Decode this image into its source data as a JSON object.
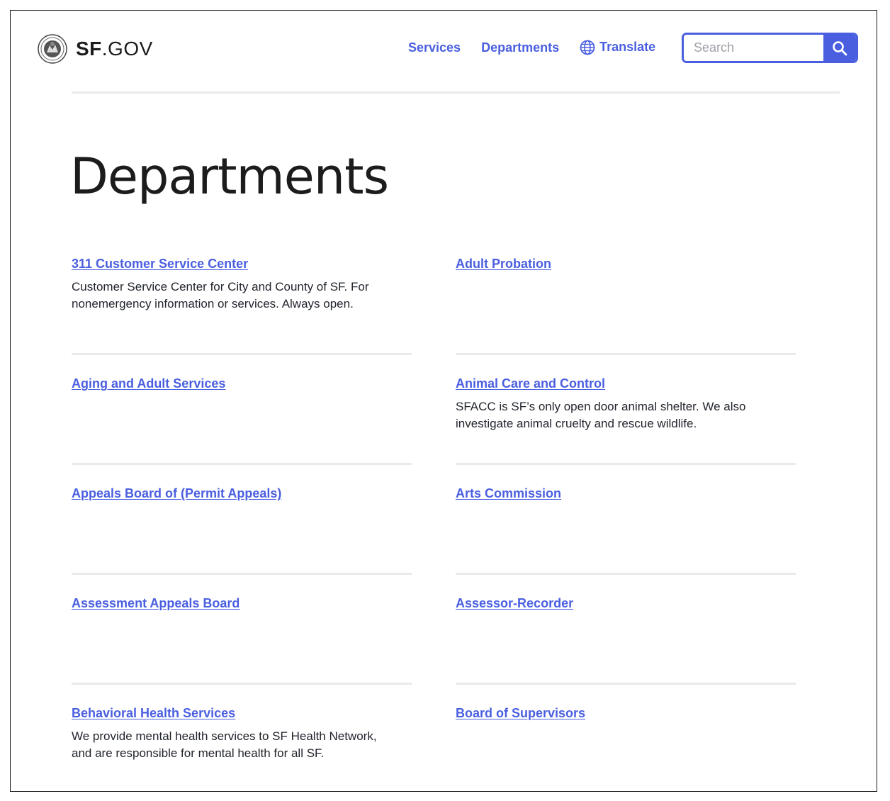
{
  "header": {
    "brand_bold": "SF",
    "brand_rest": ".GOV",
    "nav": {
      "services": "Services",
      "departments": "Departments",
      "translate": "Translate"
    },
    "search": {
      "placeholder": "Search",
      "value": ""
    }
  },
  "page": {
    "title": "Departments"
  },
  "departments": [
    {
      "name": "311 Customer Service Center",
      "description": "Customer Service Center for City and County of SF. For nonemergency information or services. Always open."
    },
    {
      "name": "Adult Probation",
      "description": ""
    },
    {
      "name": "Aging and Adult Services",
      "description": ""
    },
    {
      "name": "Animal Care and Control",
      "description": "SFACC is SF’s only open door animal shelter. We also investigate animal cruelty and rescue wildlife."
    },
    {
      "name": "Appeals Board of (Permit Appeals)",
      "description": ""
    },
    {
      "name": "Arts Commission",
      "description": ""
    },
    {
      "name": "Assessment Appeals Board",
      "description": ""
    },
    {
      "name": "Assessor-Recorder",
      "description": ""
    },
    {
      "name": "Behavioral Health Services",
      "description": "We provide mental health services to SF Health Network, and are responsible for mental health for all SF."
    },
    {
      "name": "Board of Supervisors",
      "description": ""
    }
  ],
  "colors": {
    "link": "#4a5fe0",
    "rule": "#e9eaeb",
    "text": "#21252c"
  }
}
